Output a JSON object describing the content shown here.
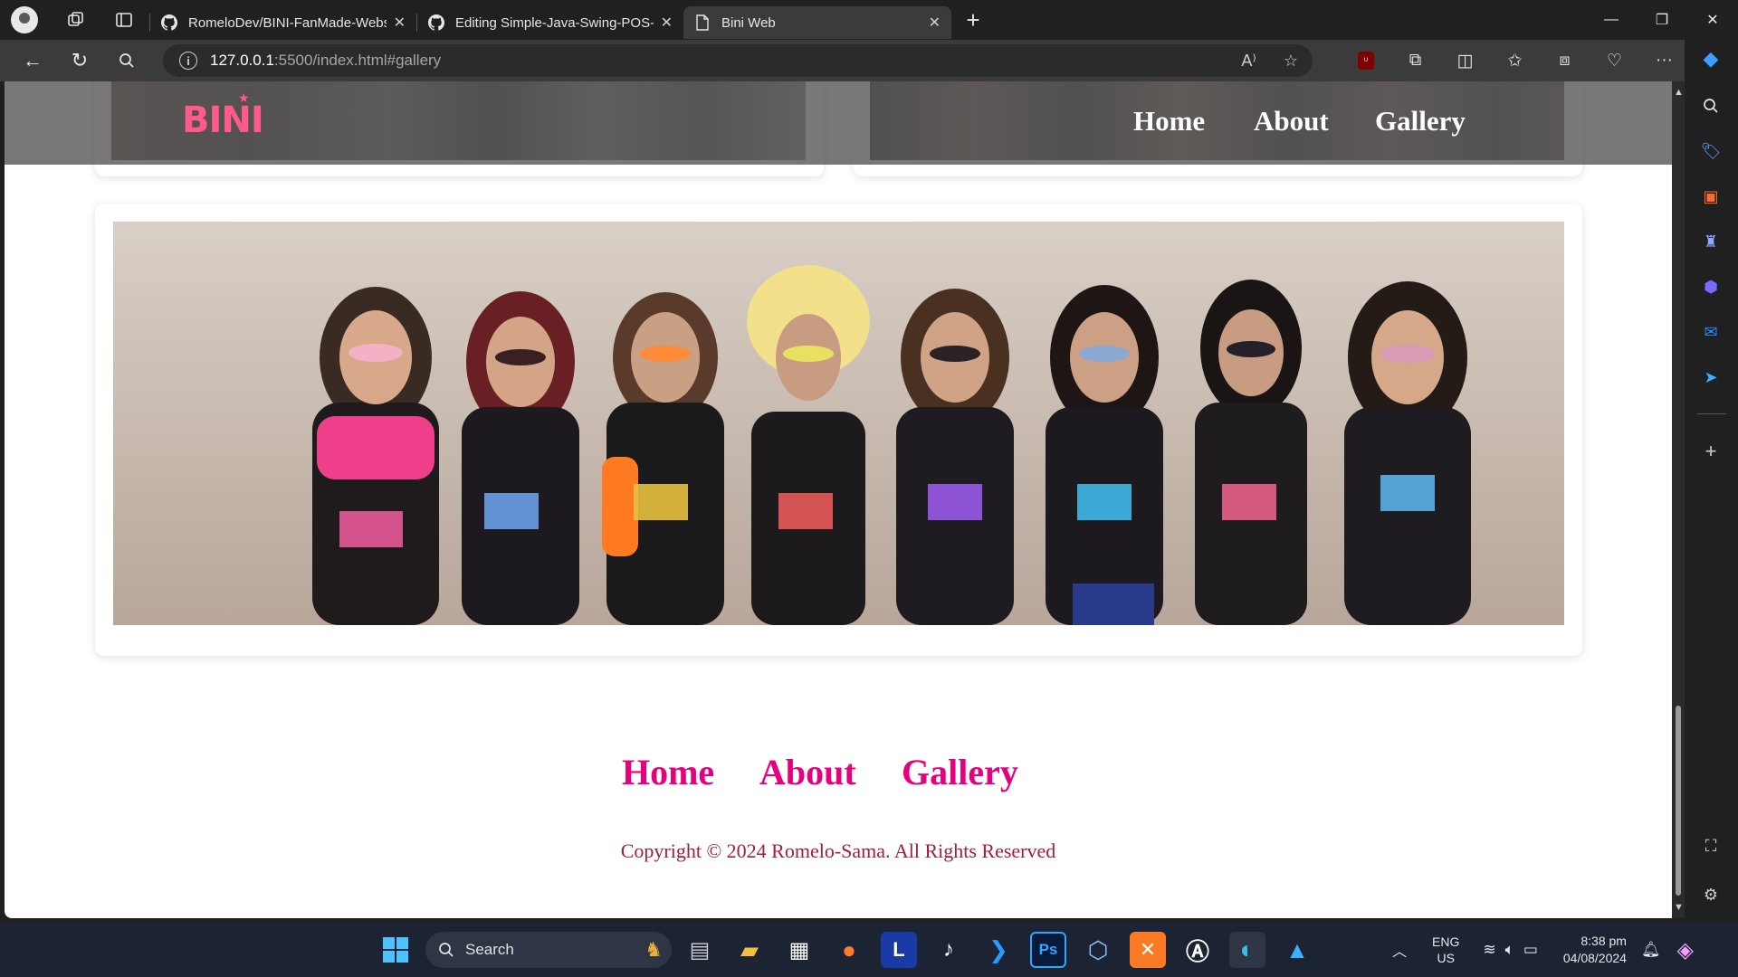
{
  "browser": {
    "tabs": [
      {
        "title": "RomeloDev/BINI-FanMade-Website",
        "favicon": "github-icon",
        "active": false
      },
      {
        "title": "Editing Simple-Java-Swing-POS-System",
        "favicon": "github-icon",
        "active": false
      },
      {
        "title": "Bini Web",
        "favicon": "page-icon",
        "active": true
      }
    ],
    "url_host": "127.0.0.1",
    "url_path": ":5500/index.html#gallery",
    "read_aloud_label": "A⁾"
  },
  "site": {
    "logo_text": "BINI",
    "header_nav": [
      "Home",
      "About",
      "Gallery"
    ],
    "footer_nav": [
      "Home",
      "About",
      "Gallery"
    ],
    "copyright": "Copyright © 2024 Romelo-Sama. All Rights Reserved",
    "accent": "#e6007e",
    "copyright_color": "#a0203a"
  },
  "taskbar": {
    "search_label": "Search",
    "lang_top": "ENG",
    "lang_bottom": "US",
    "time": "8:38 pm",
    "date": "04/08/2024",
    "pinned": [
      "windows-start-icon",
      "task-view-icon",
      "file-explorer-icon",
      "microsoft-store-icon",
      "firefox-icon",
      "l-app-icon",
      "tiktok-icon",
      "vscode-icon",
      "photoshop-icon",
      "cube-app-icon",
      "xampp-icon",
      "app-store-icon",
      "edge-icon",
      "photos-icon"
    ]
  }
}
